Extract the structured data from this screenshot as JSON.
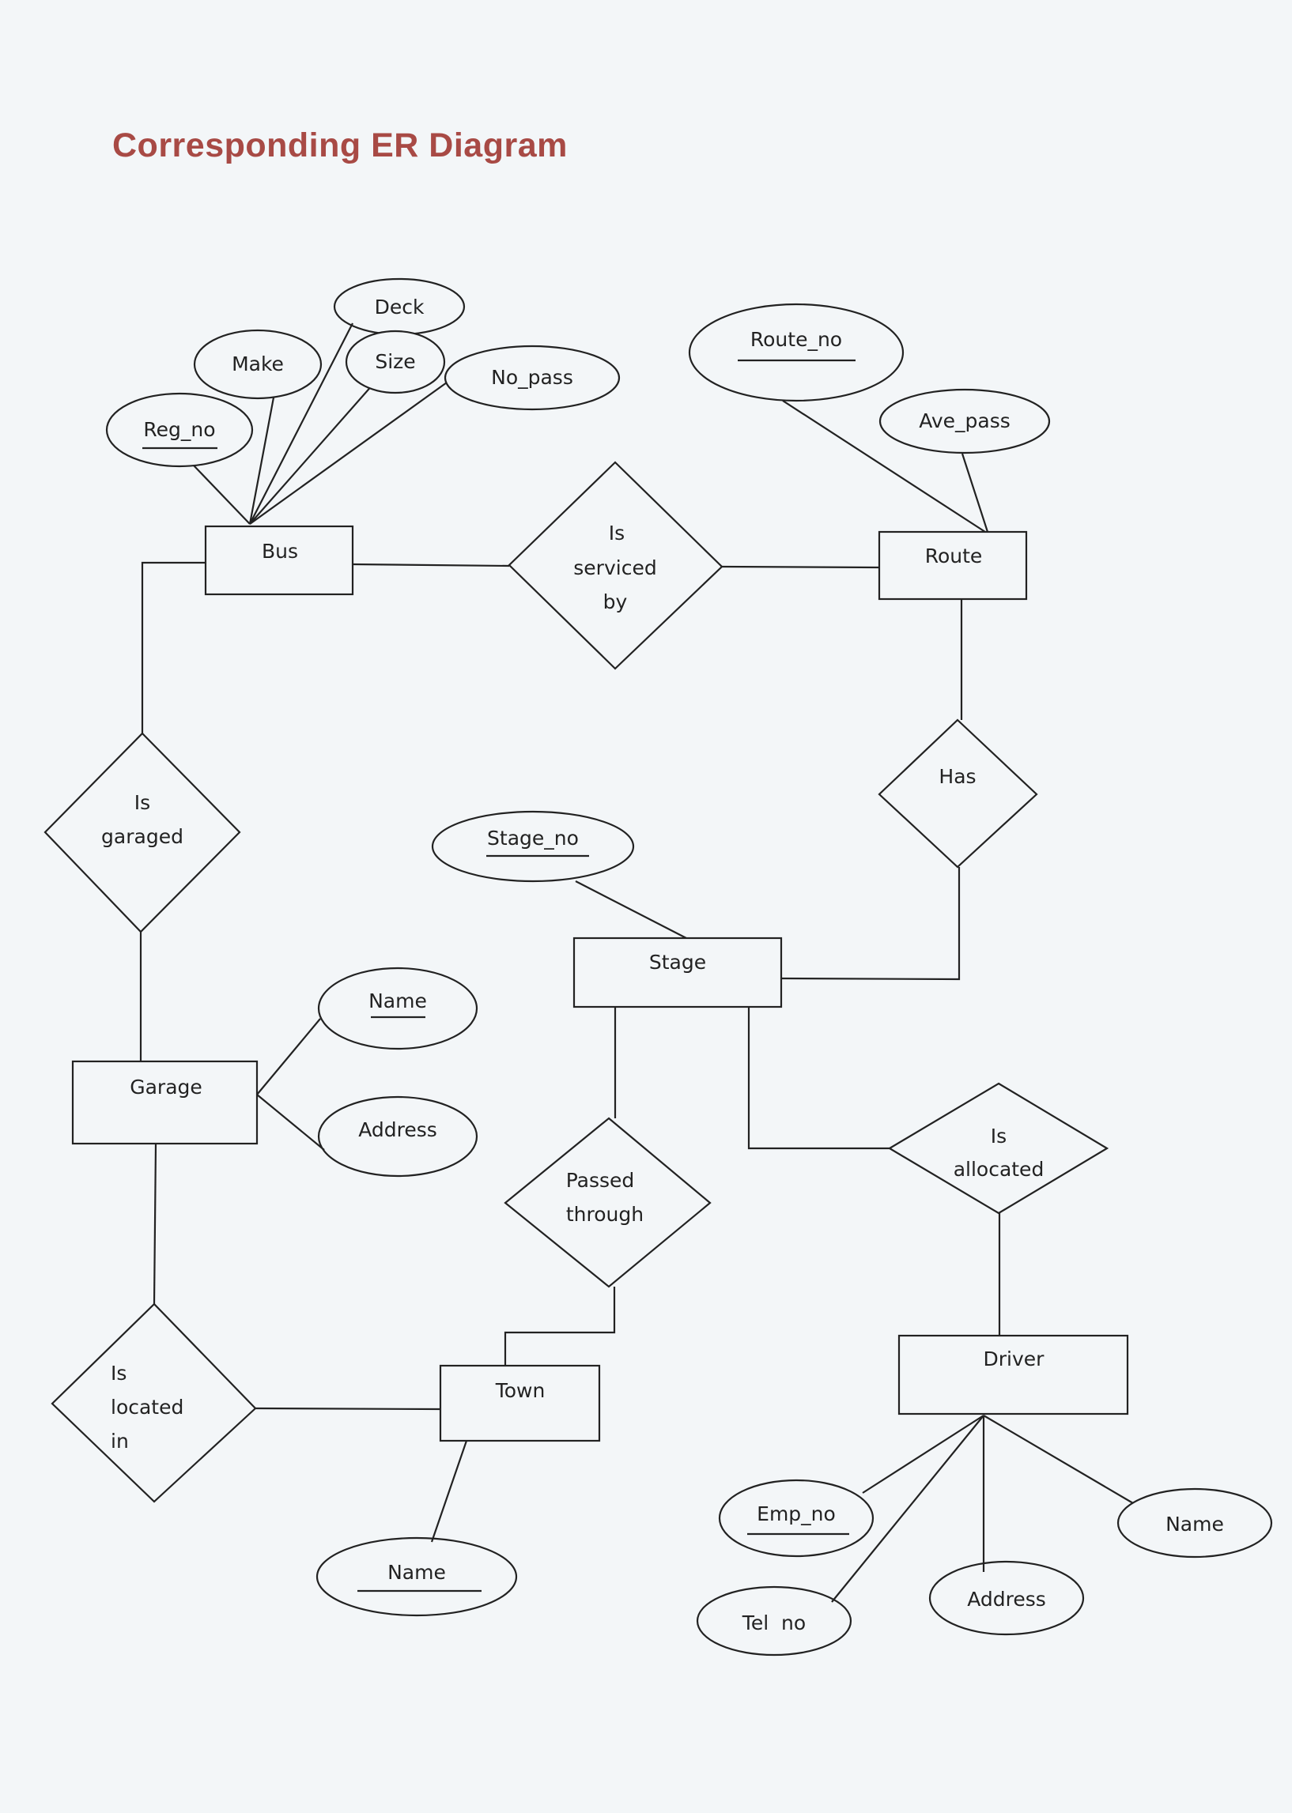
{
  "title": "Corresponding ER Diagram",
  "entities": {
    "bus": "Bus",
    "route": "Route",
    "stage": "Stage",
    "garage": "Garage",
    "town": "Town",
    "driver": "Driver"
  },
  "relationships": {
    "is_serviced_by": [
      "Is",
      "serviced",
      "by"
    ],
    "has": [
      "Has"
    ],
    "is_garaged": [
      "Is",
      "garaged"
    ],
    "passed_through": [
      "Passed",
      "through"
    ],
    "is_allocated": [
      "Is",
      "allocated"
    ],
    "is_located_in": [
      "Is",
      "located",
      "in"
    ]
  },
  "attributes": {
    "bus_reg_no": {
      "label": "Reg_no",
      "key": true
    },
    "bus_make": {
      "label": "Make",
      "key": false
    },
    "bus_deck": {
      "label": "Deck",
      "key": false
    },
    "bus_size": {
      "label": "Size",
      "key": false
    },
    "bus_no_pass": {
      "label": "No_pass",
      "key": false
    },
    "route_route_no": {
      "label": "Route_no",
      "key": true
    },
    "route_ave_pass": {
      "label": "Ave_pass",
      "key": false
    },
    "stage_stage_no": {
      "label": "Stage_no",
      "key": true
    },
    "garage_name": {
      "label": "Name",
      "key": true
    },
    "garage_address": {
      "label": "Address",
      "key": false
    },
    "town_name": {
      "label": "Name",
      "key": true
    },
    "driver_emp_no": {
      "label": "Emp_no",
      "key": true
    },
    "driver_tel_no": {
      "label": "Tel  no",
      "key": false
    },
    "driver_address": {
      "label": "Address",
      "key": false
    },
    "driver_name": {
      "label": "Name",
      "key": false
    }
  }
}
